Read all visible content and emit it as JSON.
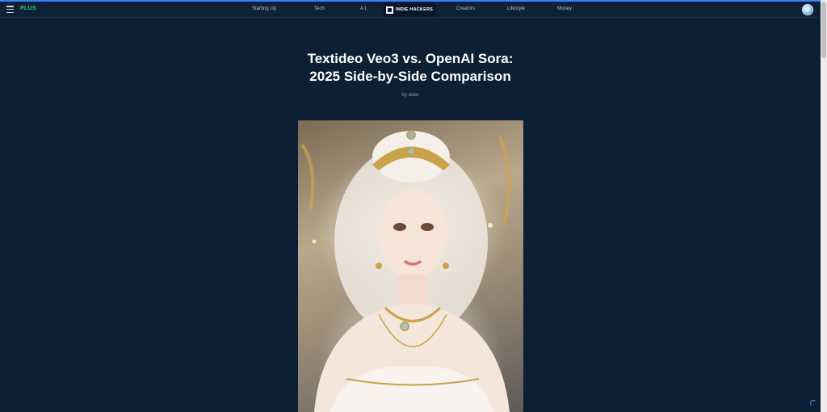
{
  "nav": {
    "plus_label": "PLUS",
    "links": [
      "Starting Up",
      "Tech",
      "A.I.",
      "Creators",
      "Lifestyle",
      "Money"
    ],
    "brand": "INDIE HACKERS"
  },
  "article": {
    "title_line1": "Textideo Veo3 vs. OpenAI Sora:",
    "title_line2": "2025 Side-by-Side Comparison",
    "byline": "by duke"
  },
  "colors": {
    "background": "#0d1f33",
    "accent": "#3b82f6",
    "plus": "#2ecc71"
  }
}
